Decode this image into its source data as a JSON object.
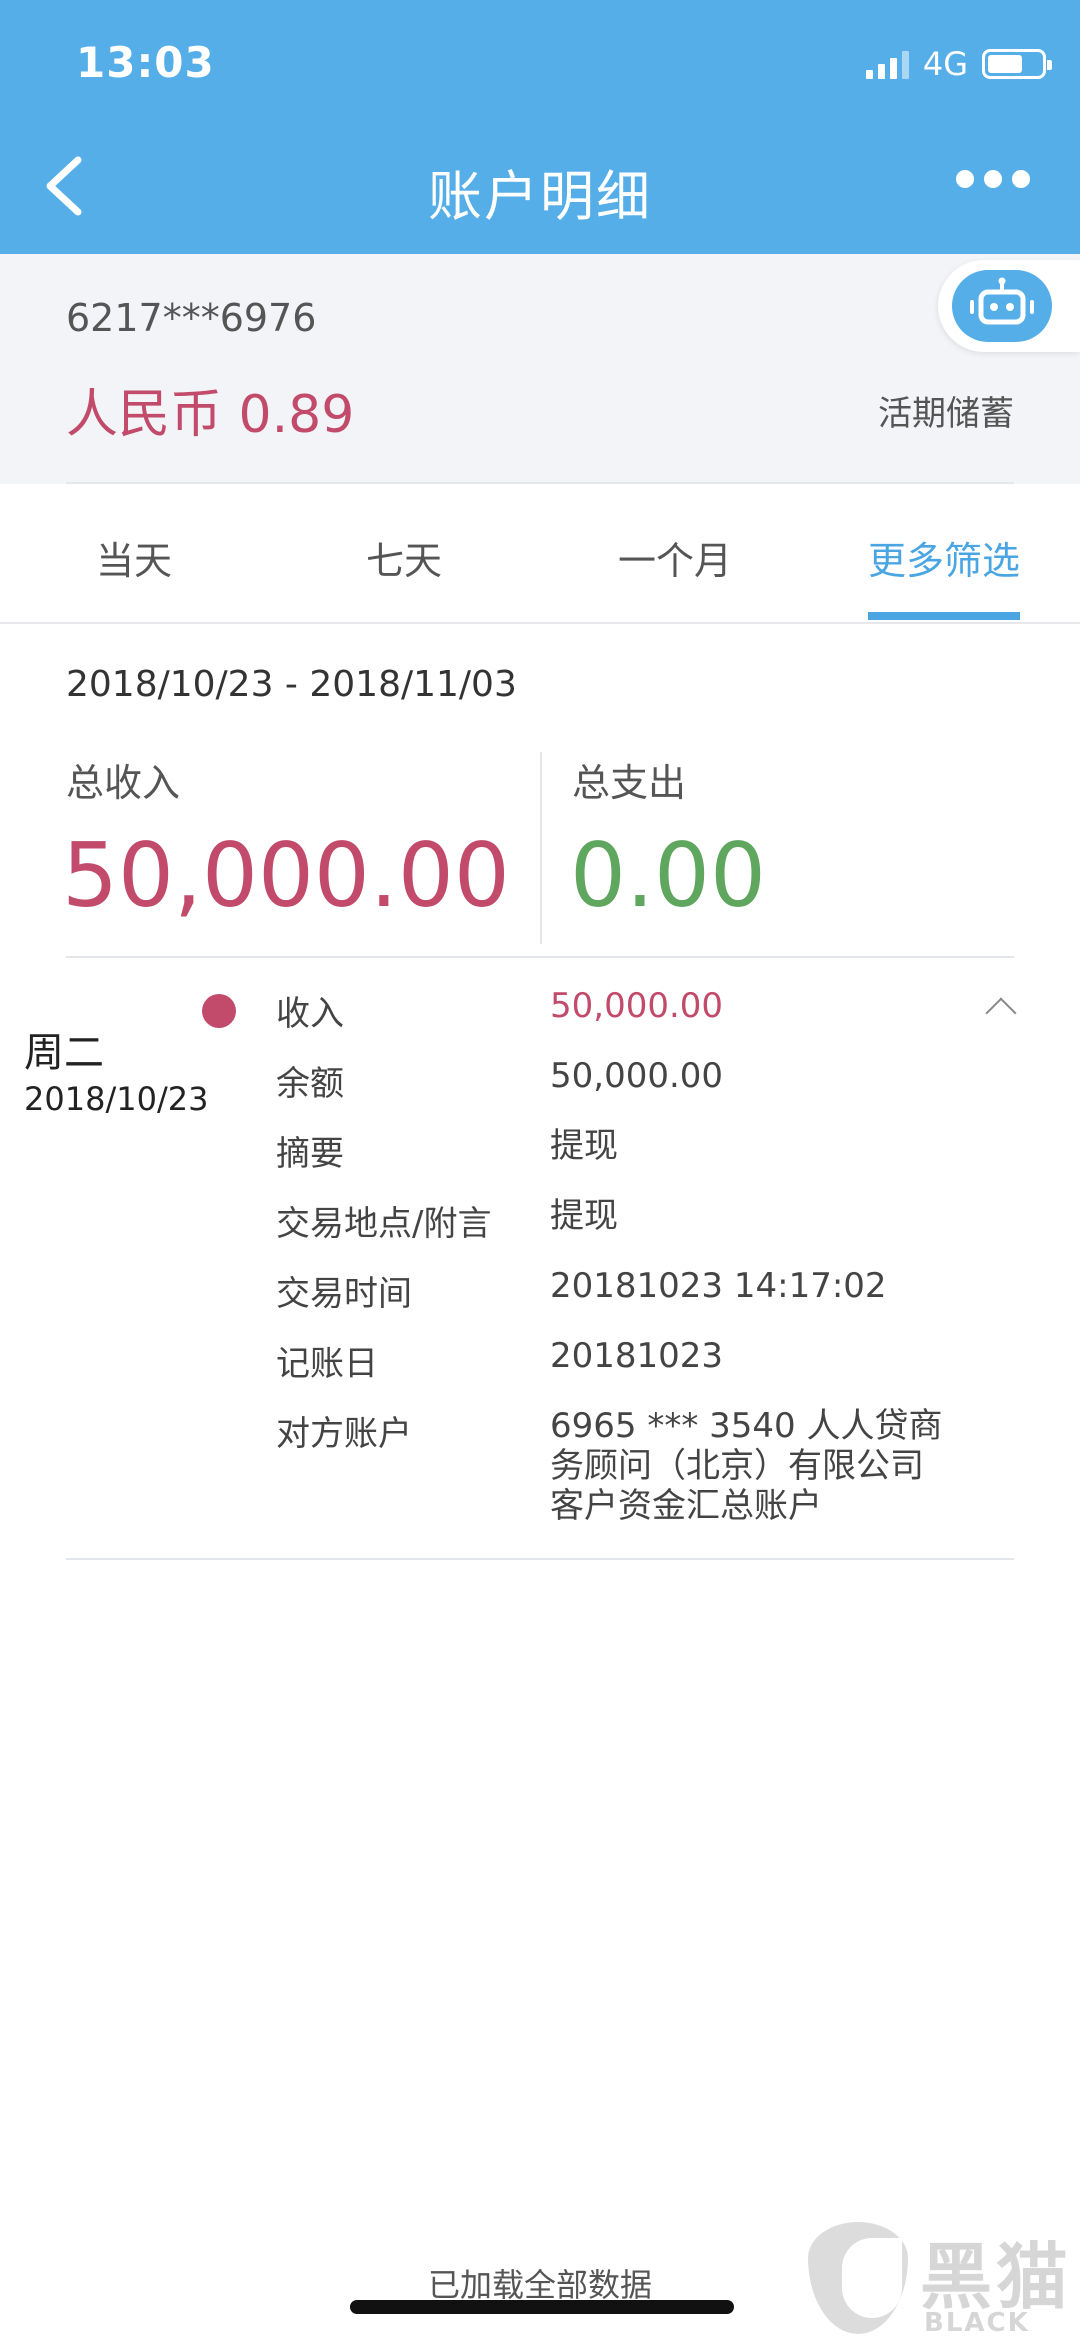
{
  "status_bar": {
    "time": "13:03",
    "network": "4G"
  },
  "header": {
    "title": "账户明细"
  },
  "account": {
    "number": "6217***6976",
    "balance": "人民币 0.89",
    "type": "活期储蓄"
  },
  "tabs": [
    {
      "label": "当天",
      "active": false
    },
    {
      "label": "七天",
      "active": false
    },
    {
      "label": "一个月",
      "active": false
    },
    {
      "label": "更多筛选",
      "active": true
    }
  ],
  "summary": {
    "date_range": "2018/10/23 - 2018/11/03",
    "income_label": "总收入",
    "income": "50,000.00",
    "expense_label": "总支出",
    "expense": "0.00"
  },
  "transaction": {
    "weekday": "周二",
    "date": "2018/10/23",
    "rows": [
      {
        "label": "收入",
        "value": "50,000.00"
      },
      {
        "label": "余额",
        "value": "50,000.00"
      },
      {
        "label": "摘要",
        "value": "提现"
      },
      {
        "label": "交易地点/附言",
        "value": "提现"
      },
      {
        "label": "交易时间",
        "value": "20181023 14:17:02"
      },
      {
        "label": "记账日",
        "value": "20181023"
      },
      {
        "label": "对方账户",
        "value_lines": [
          "6965 *** 3540 人人贷商",
          "务顾问（北京）有限公司",
          "客户资金汇总账户"
        ]
      }
    ]
  },
  "footer": {
    "text": "已加载全部数据"
  },
  "watermark": {
    "cn": "黑猫",
    "en": "BLACK CAT"
  },
  "colors": {
    "header_bg": "#55aee8",
    "income": "#c24a6a",
    "expense": "#5fa65f",
    "active_tab": "#4aa6e2"
  }
}
